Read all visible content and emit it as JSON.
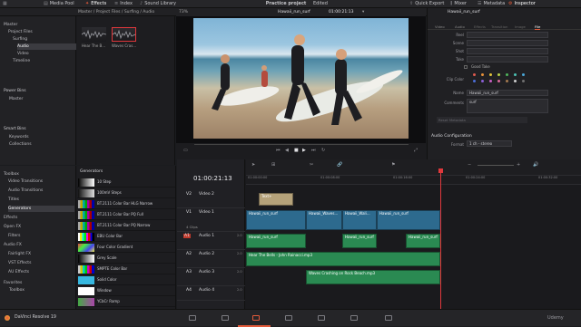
{
  "topbar": {
    "items": [
      "Media Pool",
      "Effects",
      "Index",
      "Sound Library"
    ],
    "project_title": "Practice project",
    "edited": "Edited",
    "right_items": [
      "Quick Export",
      "Mixer",
      "Metadata",
      "Inspector"
    ]
  },
  "viewer": {
    "zoom": "73%",
    "clip_name": "Hawaii_run_surf",
    "timecode": "01:00:21:13",
    "timeline_name": "Timeline 1"
  },
  "media_pool": {
    "path": "Master / Project Files / Surfing / Audio",
    "tree": [
      {
        "label": "Master",
        "depth": 0,
        "selected": false
      },
      {
        "label": "Project Files",
        "depth": 1,
        "selected": false
      },
      {
        "label": "Surfing",
        "depth": 2,
        "selected": false
      },
      {
        "label": "Audio",
        "depth": 3,
        "selected": true
      },
      {
        "label": "Video",
        "depth": 3,
        "selected": false
      },
      {
        "label": "Timeline",
        "depth": 2,
        "selected": false
      }
    ],
    "power_bins": "Power Bins",
    "power_bins_items": [
      "Master"
    ],
    "smart_bins": "Smart Bins",
    "smart_bins_items": [
      "Keywords",
      "Collections"
    ],
    "clips": [
      "Hear The B...",
      "Waves Cras..."
    ]
  },
  "inspector": {
    "clip_name": "Hawaii_run_surf",
    "tabs": [
      "Video",
      "Audio",
      "Effects",
      "Transition",
      "Image",
      "File"
    ],
    "fields": [
      {
        "label": "Reel",
        "value": ""
      },
      {
        "label": "Scene",
        "value": ""
      },
      {
        "label": "Shot",
        "value": ""
      },
      {
        "label": "Take",
        "value": ""
      }
    ],
    "good_take": "Good Take",
    "clip_color_label": "Clip Color",
    "clip_colors": [
      "#e05a4f",
      "#e8913a",
      "#e5c53a",
      "#b8d04a",
      "#4fb55b",
      "#4cc2b4",
      "#4aa7d8",
      "#4b6ed8",
      "#8a5fd6",
      "#c95fc5",
      "#d96b9a",
      "#a3794f",
      "#cfcfcf",
      "#6f6f6f"
    ],
    "name_label": "Name",
    "name_value": "Hawaii_run_surf",
    "comments_label": "Comments",
    "comments_value": "surf",
    "reset_button": "Reset Metadata",
    "audio_config": "Audio Configuration",
    "format_label": "Format",
    "format_value": "1 ch - stereo"
  },
  "effects": {
    "toolbox": "Toolbox",
    "items": [
      {
        "label": "Video Transitions",
        "indent": 1,
        "sel": false
      },
      {
        "label": "Audio Transitions",
        "indent": 1,
        "sel": false
      },
      {
        "label": "Titles",
        "indent": 1,
        "sel": false
      },
      {
        "label": "Generators",
        "indent": 1,
        "sel": true
      },
      {
        "label": "Effects",
        "indent": 0,
        "sel": false
      },
      {
        "label": "Open FX",
        "indent": 0,
        "sel": false
      },
      {
        "label": "Filters",
        "indent": 1,
        "sel": false
      },
      {
        "label": "Audio FX",
        "indent": 0,
        "sel": false
      },
      {
        "label": "Fairlight FX",
        "indent": 1,
        "sel": false
      },
      {
        "label": "VST Effects",
        "indent": 1,
        "sel": false
      },
      {
        "label": "AU Effects",
        "indent": 1,
        "sel": false
      }
    ],
    "favorites": "Favorites",
    "favorites_items": [
      "Toolbox"
    ],
    "generators_title": "Generators",
    "generators": [
      {
        "label": "10 Step",
        "swatch": "linear-gradient(90deg,#000,#fff)"
      },
      {
        "label": "100mV Steps",
        "swatch": "linear-gradient(90deg,#111,#ddd)"
      },
      {
        "label": "BT.2111 Color Bar HLG Narrow",
        "swatch": "linear-gradient(90deg,#aaa 0 14%,#ba0 14% 28%,#0aa 28% 42%,#0a0 42% 56%,#a0a 56% 70%,#a00 70% 84%,#00a 84%)"
      },
      {
        "label": "BT.2111 Color Bar PQ Full",
        "swatch": "linear-gradient(90deg,#aaa 0 14%,#ba0 14% 28%,#0aa 28% 42%,#0a0 42% 56%,#a0a 56% 70%,#a00 70% 84%,#00a 84%)"
      },
      {
        "label": "BT.2111 Color Bar PQ Narrow",
        "swatch": "linear-gradient(90deg,#aaa 0 14%,#ba0 14% 28%,#0aa 28% 42%,#0a0 42% 56%,#a0a 56% 70%,#a00 70% 84%,#00a 84%)"
      },
      {
        "label": "EBU Color Bar",
        "swatch": "linear-gradient(90deg,#fff 0 12%,#ee0 12% 25%,#0ee 25% 37%,#0e0 37% 50%,#e0e 50% 62%,#e00 62% 75%,#00e 75% 87%,#000 87%)"
      },
      {
        "label": "Four Color Gradient",
        "swatch": "linear-gradient(135deg,#e44,#4e4,#44e,#ee4)"
      },
      {
        "label": "Grey Scale",
        "swatch": "linear-gradient(90deg,#000,#fff)"
      },
      {
        "label": "SMPTE Color Bar",
        "swatch": "linear-gradient(90deg,#ccc 0 14%,#cc0 14% 28%,#0cc 28% 42%,#0c0 42% 56%,#c0c 56% 70%,#c00 70% 84%,#00c 84%)"
      },
      {
        "label": "Solid Color",
        "swatch": "#37b8e0"
      },
      {
        "label": "Window",
        "swatch": "#ffffff"
      },
      {
        "label": "YCbCr Ramp",
        "swatch": "linear-gradient(90deg,#4a4,#a4a)"
      }
    ]
  },
  "timeline": {
    "timecode": "01:00:21:13",
    "ruler": [
      "01:00:00:00",
      "01:00:08:00",
      "01:00:16:00",
      "01:00:24:00",
      "01:00:32:00",
      "01:00:40:00"
    ],
    "clips_count": "4 Clips",
    "tracks": [
      {
        "id": "V2",
        "name": "Video 2",
        "type": "v",
        "height": 20
      },
      {
        "id": "V1",
        "name": "Video 1",
        "type": "v",
        "height": 26
      },
      {
        "id": "A1",
        "name": "Audio 1",
        "type": "a",
        "height": 20
      },
      {
        "id": "A2",
        "name": "Audio 2",
        "type": "a",
        "height": 20
      },
      {
        "id": "A3",
        "name": "Audio 3",
        "type": "a",
        "height": 20
      },
      {
        "id": "A4",
        "name": "Audio 4",
        "type": "a",
        "height": 16
      }
    ],
    "track_level": "2.0",
    "video2_clip": "Text+",
    "video1_clips": [
      "Hawaii_run_surf",
      "Hawaii_Waves...",
      "Hawaii_Wali...",
      "Hawaii_run_surf"
    ],
    "audio1_clips": [
      "Hawaii_run_surf",
      "Hawaii_run_surf",
      "Hawaii_run_surf"
    ],
    "audio2_clip": "Hear The Bells - John Rainacci.mp3",
    "audio3_clip": "Waves Crashing on Rock Beach.mp3"
  },
  "bottombar": {
    "app": "DaVinci Resolve 19",
    "watermark": "Udemy"
  },
  "colors": {
    "accent": "#e35a3a",
    "playhead": "#e0383c",
    "video_clip": "#2d6a8e",
    "audio_clip": "#2a8a52"
  }
}
